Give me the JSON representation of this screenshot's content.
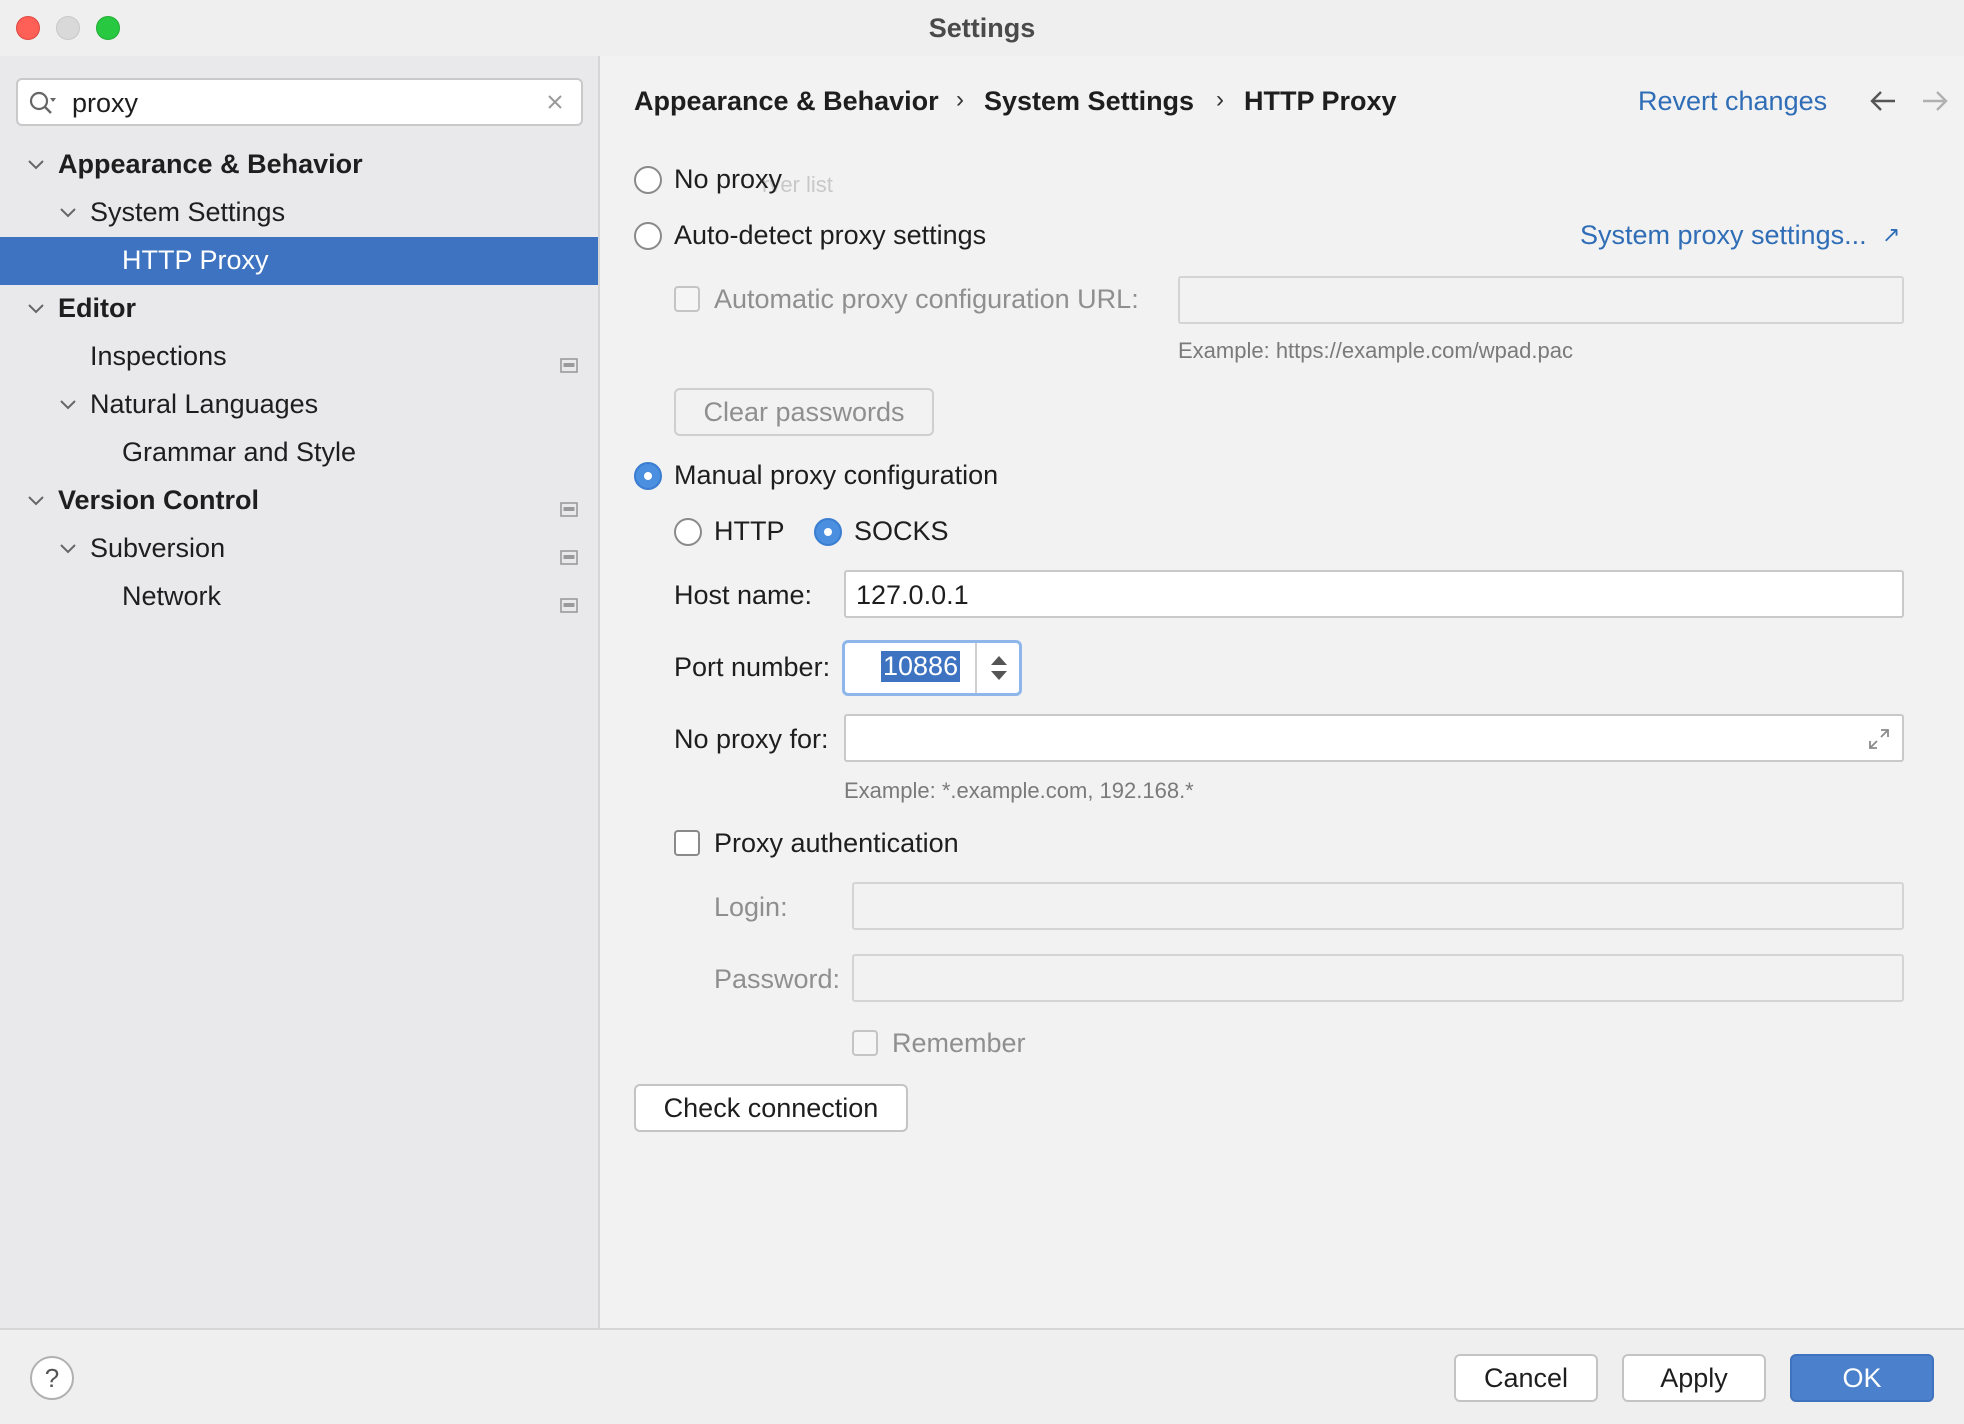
{
  "window": {
    "title": "Settings"
  },
  "search": {
    "value": "proxy"
  },
  "sidebar": {
    "items": [
      {
        "label": "Appearance & Behavior"
      },
      {
        "label": "System Settings"
      },
      {
        "label": "HTTP Proxy"
      },
      {
        "label": "Editor"
      },
      {
        "label": "Inspections"
      },
      {
        "label": "Natural Languages"
      },
      {
        "label": "Grammar and Style"
      },
      {
        "label": "Version Control"
      },
      {
        "label": "Subversion"
      },
      {
        "label": "Network"
      }
    ]
  },
  "breadcrumb": {
    "items": [
      "Appearance & Behavior",
      "System Settings",
      "HTTP Proxy"
    ],
    "separator": "›"
  },
  "header": {
    "revert": "Revert changes",
    "back_arrow": "←",
    "forward_arrow": "→"
  },
  "proxy": {
    "no_proxy": "No proxy",
    "ghost_text": "rver list",
    "auto_detect": "Auto-detect proxy settings",
    "system_link": "System proxy settings...",
    "system_link_icon": "↗",
    "auto_url_label": "Automatic proxy configuration URL:",
    "auto_url_example": "Example: https://example.com/wpad.pac",
    "clear_passwords": "Clear passwords",
    "manual": "Manual proxy configuration",
    "http": "HTTP",
    "socks": "SOCKS",
    "host_label": "Host name:",
    "host_value": "127.0.0.1",
    "port_label": "Port number:",
    "port_value": "10886",
    "no_proxy_for_label": "No proxy for:",
    "no_proxy_for_example": "Example: *.example.com, 192.168.*",
    "auth": "Proxy authentication",
    "login_label": "Login:",
    "password_label": "Password:",
    "remember": "Remember",
    "check_connection": "Check connection"
  },
  "footer": {
    "help": "?",
    "cancel": "Cancel",
    "apply": "Apply",
    "ok": "OK"
  },
  "colors": {
    "accent": "#3d73c0",
    "link": "#2f6db6",
    "radio_on": "#4a8fe0"
  }
}
